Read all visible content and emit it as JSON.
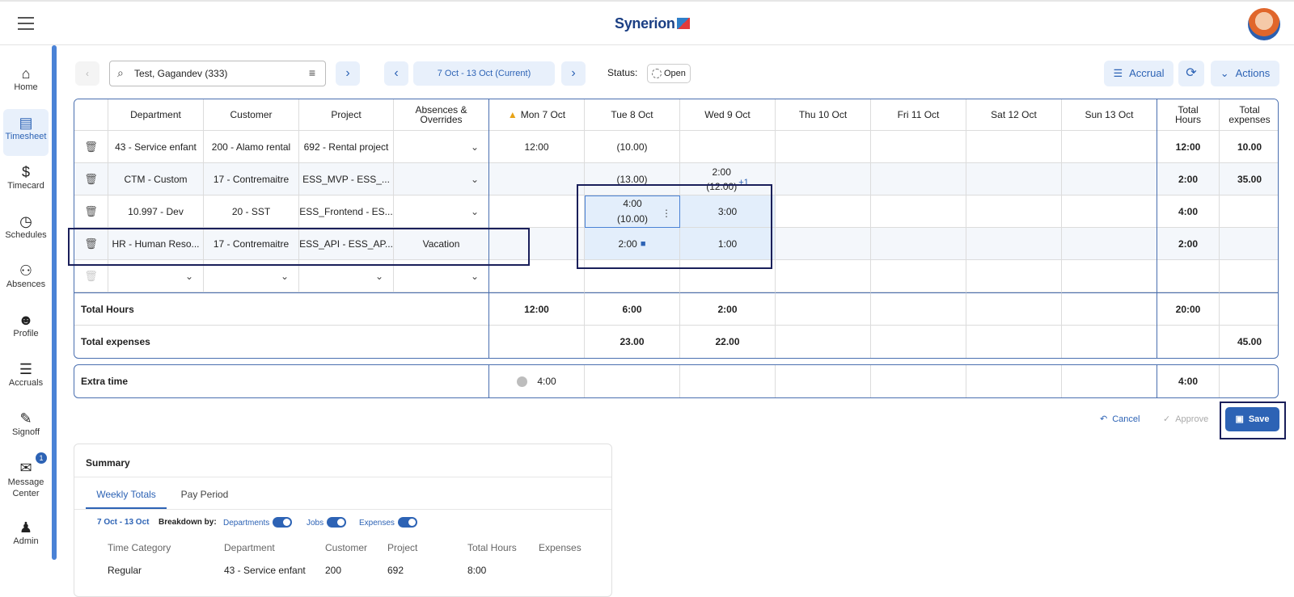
{
  "app": {
    "brand": "Synerion"
  },
  "nav": [
    {
      "label": "Home",
      "icon": "home-icon"
    },
    {
      "label": "Timesheet",
      "icon": "timesheet-icon"
    },
    {
      "label": "Timecard",
      "icon": "dollar-icon"
    },
    {
      "label": "Schedules",
      "icon": "clock-icon"
    },
    {
      "label": "Absences",
      "icon": "absence-icon"
    },
    {
      "label": "Profile",
      "icon": "people-icon"
    },
    {
      "label": "Accruals",
      "icon": "accruals-icon"
    },
    {
      "label": "Signoff",
      "icon": "signoff-icon"
    },
    {
      "label": "Message\nCenter",
      "icon": "message-icon",
      "badge": "1"
    },
    {
      "label": "Admin",
      "icon": "admin-icon"
    }
  ],
  "toolbar": {
    "employee": "Test, Gagandev (333)",
    "period": "7 Oct - 13 Oct (Current)",
    "status_label": "Status:",
    "status_value": "Open",
    "accrual": "Accrual",
    "actions": "Actions"
  },
  "grid": {
    "headers": [
      "Department",
      "Customer",
      "Project",
      "Absences &\nOverrides",
      "Mon 7 Oct",
      "Tue 8 Oct",
      "Wed 9 Oct",
      "Thu 10 Oct",
      "Fri 11 Oct",
      "Sat 12 Oct",
      "Sun 13 Oct",
      "Total\nHours",
      "Total\nexpenses"
    ],
    "rows": [
      {
        "dept": "43 - Service enfant",
        "cust": "200 - Alamo rental",
        "proj": "692 - Rental project",
        "abs": "",
        "mon": "12:00",
        "tue": "(10.00)",
        "wed": "",
        "total": "12:00",
        "exp": "10.00"
      },
      {
        "dept": "CTM - Custom",
        "cust": "17 - Contremaitre",
        "proj": "ESS_MVP - ESS_...",
        "abs": "",
        "mon": "",
        "tue": "(13.00)",
        "wed": "2:00\n(12.00)",
        "wed_extra": "+1",
        "total": "2:00",
        "exp": "35.00"
      },
      {
        "dept": "10.997 - Dev",
        "cust": "20 - SST",
        "proj": "ESS_Frontend - ES...",
        "abs": "",
        "mon": "",
        "tue": "4:00\n(10.00)",
        "wed": "3:00",
        "total": "4:00",
        "exp": ""
      },
      {
        "dept": "HR - Human Reso...",
        "cust": "17 - Contremaitre",
        "proj": "ESS_API - ESS_AP...",
        "abs": "Vacation",
        "mon": "",
        "tue": "2:00",
        "wed": "1:00",
        "total": "2:00",
        "exp": ""
      }
    ],
    "total_hours": {
      "label": "Total Hours",
      "mon": "12:00",
      "tue": "6:00",
      "wed": "2:00",
      "total": "20:00"
    },
    "total_expenses": {
      "label": "Total expenses",
      "tue": "23.00",
      "wed": "22.00",
      "exp": "45.00"
    }
  },
  "extra_time": {
    "label": "Extra time",
    "mon": "4:00",
    "total": "4:00"
  },
  "footer_actions": {
    "cancel": "Cancel",
    "approve": "Approve",
    "save": "Save"
  },
  "summary": {
    "title": "Summary",
    "tabs": [
      "Weekly Totals",
      "Pay Period"
    ],
    "range": "7 Oct - 13 Oct",
    "breakdown_label": "Breakdown by:",
    "toggles": [
      "Departments",
      "Jobs",
      "Expenses"
    ],
    "columns": [
      "Time Category",
      "Department",
      "Customer",
      "Project",
      "Total Hours",
      "Expenses"
    ],
    "rows": [
      [
        "Regular",
        "43 - Service enfant",
        "200",
        "692",
        "8:00",
        ""
      ]
    ]
  },
  "colors": {
    "accent": "#2d63b5",
    "highlight": "#1a1f5a"
  }
}
